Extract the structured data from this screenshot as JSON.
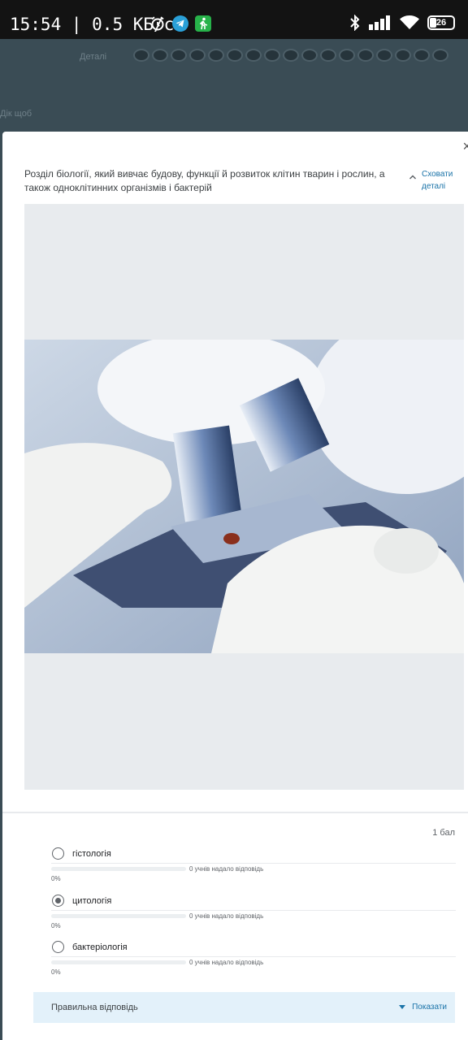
{
  "status_bar": {
    "time": "15:54",
    "net_speed": "| 0.5 КБ/с",
    "battery": "26"
  },
  "background": {
    "filter_label": "Деталі",
    "back_label": "Дік щоб"
  },
  "question": {
    "text": "Розділ біології, який вивчає будову, функції й розвиток клітин тварин і рослин, а також одноклітинних організмів і бактерій",
    "hide_details": "Сховати деталі",
    "points": "1 бал",
    "options": [
      {
        "label": "гістологія",
        "answered": "0 учнів надало відповідь",
        "percent": "0%",
        "fill": 0,
        "selected": false
      },
      {
        "label": "цитологія",
        "answered": "0 учнів надало відповідь",
        "percent": "0%",
        "fill": 0,
        "selected": true
      },
      {
        "label": "бактеріологія",
        "answered": "0 учнів надало відповідь",
        "percent": "0%",
        "fill": 0,
        "selected": false
      }
    ],
    "correct_answer_label": "Правильна відповідь",
    "show_label": "Показати"
  },
  "colors": {
    "accent": "#1a73a8",
    "panel": "#e3f1fa",
    "statusbar": "#131313"
  },
  "icons": {
    "alarm": "alarm-icon",
    "telegram": "telegram-icon",
    "walk": "walk-icon",
    "bluetooth": "bluetooth-icon",
    "signal": "signal-icon",
    "wifi": "wifi-icon",
    "battery": "battery-icon",
    "close": "close-icon",
    "chevron_up": "chevron-up-icon",
    "caret_down": "caret-down-icon"
  }
}
